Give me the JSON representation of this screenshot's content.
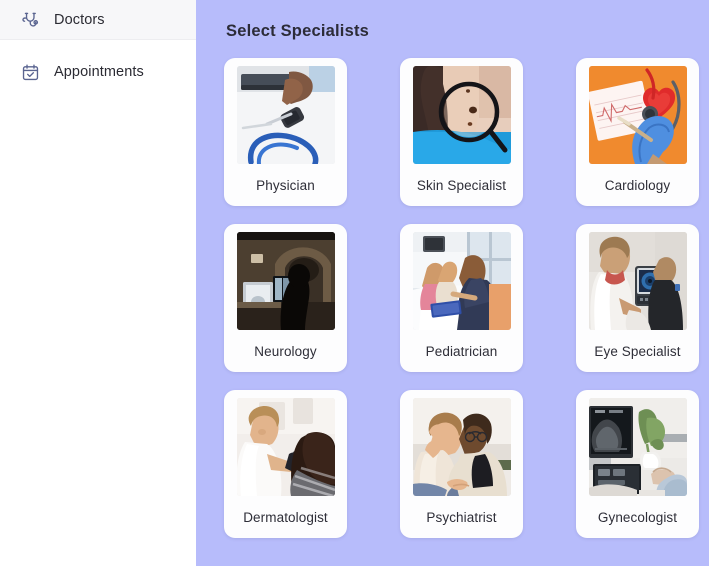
{
  "sidebar": {
    "items": [
      {
        "label": "Doctors",
        "icon": "stethoscope-icon",
        "active": true
      },
      {
        "label": "Appointments",
        "icon": "calendar-check-icon",
        "active": false
      }
    ]
  },
  "panel": {
    "title": "Select Specialists",
    "background_color": "#b7bcfb",
    "cards": [
      {
        "label": "Physician",
        "photo": "hand-with-watch-stethoscope-clipboard"
      },
      {
        "label": "Skin Specialist",
        "photo": "magnifier-over-skin-moles"
      },
      {
        "label": "Cardiology",
        "photo": "ecg-chart-red-heart-blue-glove-orange"
      },
      {
        "label": "Neurology",
        "photo": "mri-scanner-room-dark"
      },
      {
        "label": "Pediatrician",
        "photo": "clinic-room-doctor-with-children"
      },
      {
        "label": "Eye Specialist",
        "photo": "optometrist-eye-exam-machine"
      },
      {
        "label": "Dermatologist",
        "photo": "dermatologist-black-gloves-patient"
      },
      {
        "label": "Psychiatrist",
        "photo": "counselling-session-two-women"
      },
      {
        "label": "Gynecologist",
        "photo": "ultrasound-monitor-patient-plant"
      }
    ]
  }
}
